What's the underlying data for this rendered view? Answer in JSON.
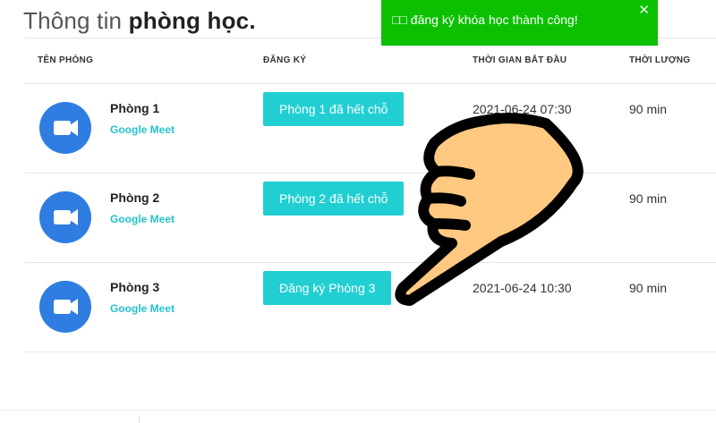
{
  "page": {
    "title_light": "Thông tin",
    "title_bold": "phòng học."
  },
  "table": {
    "headers": {
      "room": "TÊN PHÒNG",
      "register": "ĐĂNG KÝ",
      "start_time": "THỜI GIAN BẮT ĐẦU",
      "duration": "THỜI LƯỢNG"
    },
    "rows": [
      {
        "name": "Phòng 1",
        "provider": "Google Meet",
        "button": "Phòng 1 đã hết chỗ",
        "start": "2021-06-24 07:30",
        "duration": "90 min"
      },
      {
        "name": "Phòng 2",
        "provider": "Google Meet",
        "button": "Phòng 2 đã hết chỗ",
        "start": "",
        "duration": "90 min"
      },
      {
        "name": "Phòng 3",
        "provider": "Google Meet",
        "button": "Đăng ký Phòng 3",
        "start": "2021-06-24 10:30",
        "duration": "90 min"
      }
    ]
  },
  "toast": {
    "message": "□□ đăng ký khóa học thành công!",
    "close": "✕"
  },
  "colors": {
    "accent": "#21cfd3",
    "toast_bg": "#0cc000",
    "meet_icon": "#2f7de1"
  },
  "icons": {
    "meet": "google-meet-icon",
    "pointer": "pointing-hand-icon"
  }
}
